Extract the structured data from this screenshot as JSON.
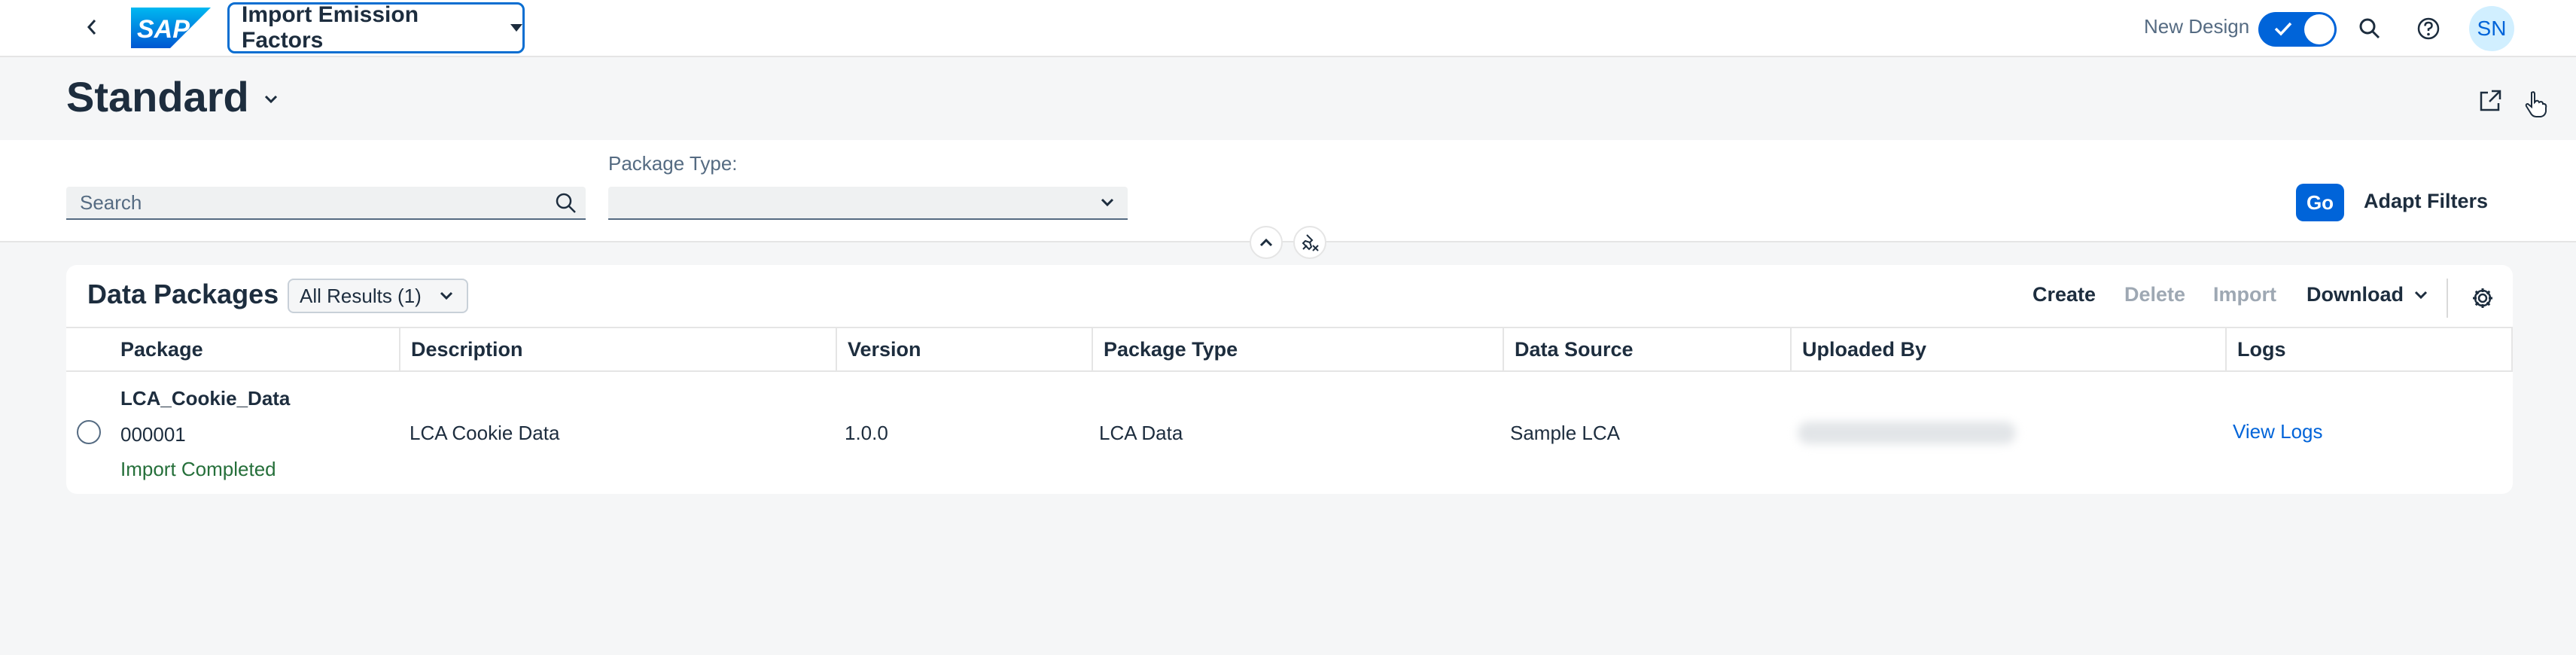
{
  "shell": {
    "app_title": "Import Emission Factors",
    "logo_text": "SAP",
    "new_design_label": "New Design",
    "avatar_initials": "SN"
  },
  "page": {
    "variant_title": "Standard"
  },
  "filters": {
    "search_placeholder": "Search",
    "package_type_label": "Package Type:",
    "package_type_value": "",
    "go_label": "Go",
    "adapt_filters_label": "Adapt Filters"
  },
  "table": {
    "title": "Data Packages",
    "results_selector": "All Results (1)",
    "toolbar": {
      "create": "Create",
      "delete": "Delete",
      "import": "Import",
      "download": "Download"
    },
    "columns": [
      "Package",
      "Description",
      "Version",
      "Package Type",
      "Data Source",
      "Uploaded By",
      "Logs"
    ],
    "rows": [
      {
        "package_name": "LCA_Cookie_Data",
        "package_id": "000001",
        "status": "Import Completed",
        "description": "LCA Cookie Data",
        "version": "1.0.0",
        "package_type": "LCA Data",
        "data_source": "Sample LCA",
        "uploaded_by": "",
        "logs_link": "View Logs"
      }
    ]
  },
  "colors": {
    "brand_blue": "#0064d9",
    "success_green": "#256f3a",
    "text_primary": "#1d2d3e"
  }
}
